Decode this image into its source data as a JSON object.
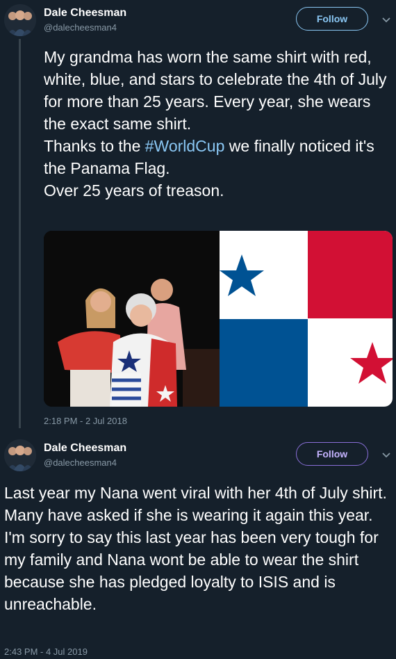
{
  "tweets": [
    {
      "author": {
        "name": "Dale Cheesman",
        "handle": "@dalecheesman4",
        "avatar": "profile-photo"
      },
      "follow_label": "Follow",
      "text_before": "My grandma has worn the same shirt with red, white, blue, and stars to celebrate the 4th of July for more than 25 years. Every year, she wears the exact same shirt.\nThanks to the ",
      "hashtag": "#WorldCup",
      "text_after": " we finally noticed it's the Panama Flag.\nOver 25 years of treason.",
      "media": {
        "photo": "grandma-family-photo",
        "flag": "panama-flag"
      },
      "timestamp": "2:18 PM - 2 Jul 2018"
    },
    {
      "author": {
        "name": "Dale Cheesman",
        "handle": "@dalecheesman4",
        "avatar": "profile-photo"
      },
      "follow_label": "Follow",
      "text": "Last year my Nana went viral with her 4th of July shirt. Many have asked if she is wearing it again this year. I'm sorry to say this last year has been very tough for my family and Nana wont be able to wear the shirt because she has pledged loyalty to ISIS and is unreachable.",
      "timestamp": "2:43 PM - 4 Jul 2019"
    }
  ],
  "colors": {
    "background": "#15202b",
    "text": "#ffffff",
    "secondary": "#8899a6",
    "link": "#8ac7f4",
    "flag_red": "#d21034",
    "flag_blue": "#005293"
  }
}
